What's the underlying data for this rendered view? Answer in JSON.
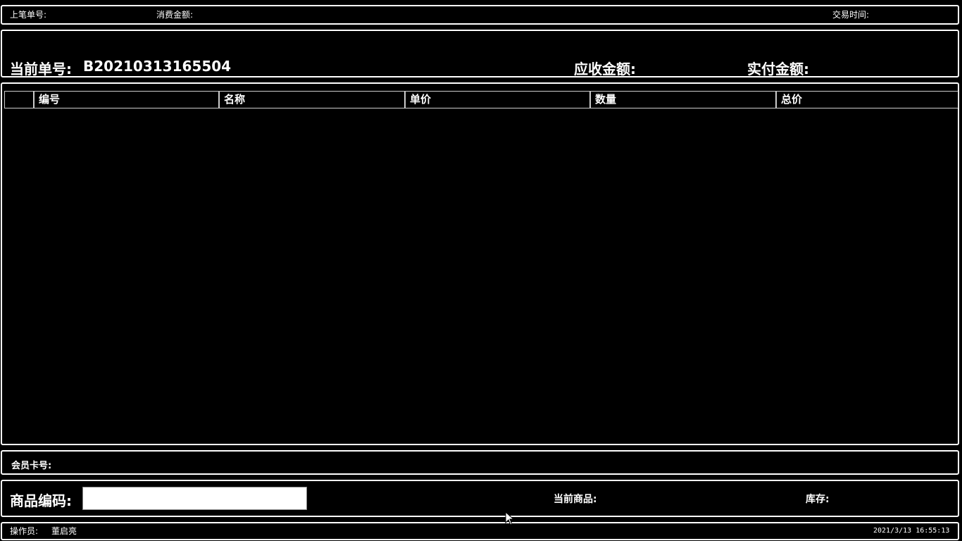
{
  "top_bar": {
    "last_order_label": "上笔单号:",
    "amount_label": "消费金额:",
    "time_label": "交易时间:"
  },
  "order_header": {
    "current_order_label": "当前单号:",
    "current_order_value": "B20210313165504",
    "receivable_label": "应收金额:",
    "paid_label": "实付金额:"
  },
  "table": {
    "columns": [
      "编号",
      "名称",
      "单价",
      "数量",
      "总价"
    ],
    "rows": []
  },
  "member": {
    "card_label": "会员卡号:"
  },
  "product_entry": {
    "code_label": "商品编码:",
    "code_value": "",
    "current_product_label": "当前商品:",
    "stock_label": "库存:"
  },
  "status_bar": {
    "operator_label": "操作员:",
    "operator_name": "董启亮",
    "datetime": "2021/3/13 16:55:13"
  },
  "icons": {
    "cursor": "mouse-pointer-icon"
  }
}
